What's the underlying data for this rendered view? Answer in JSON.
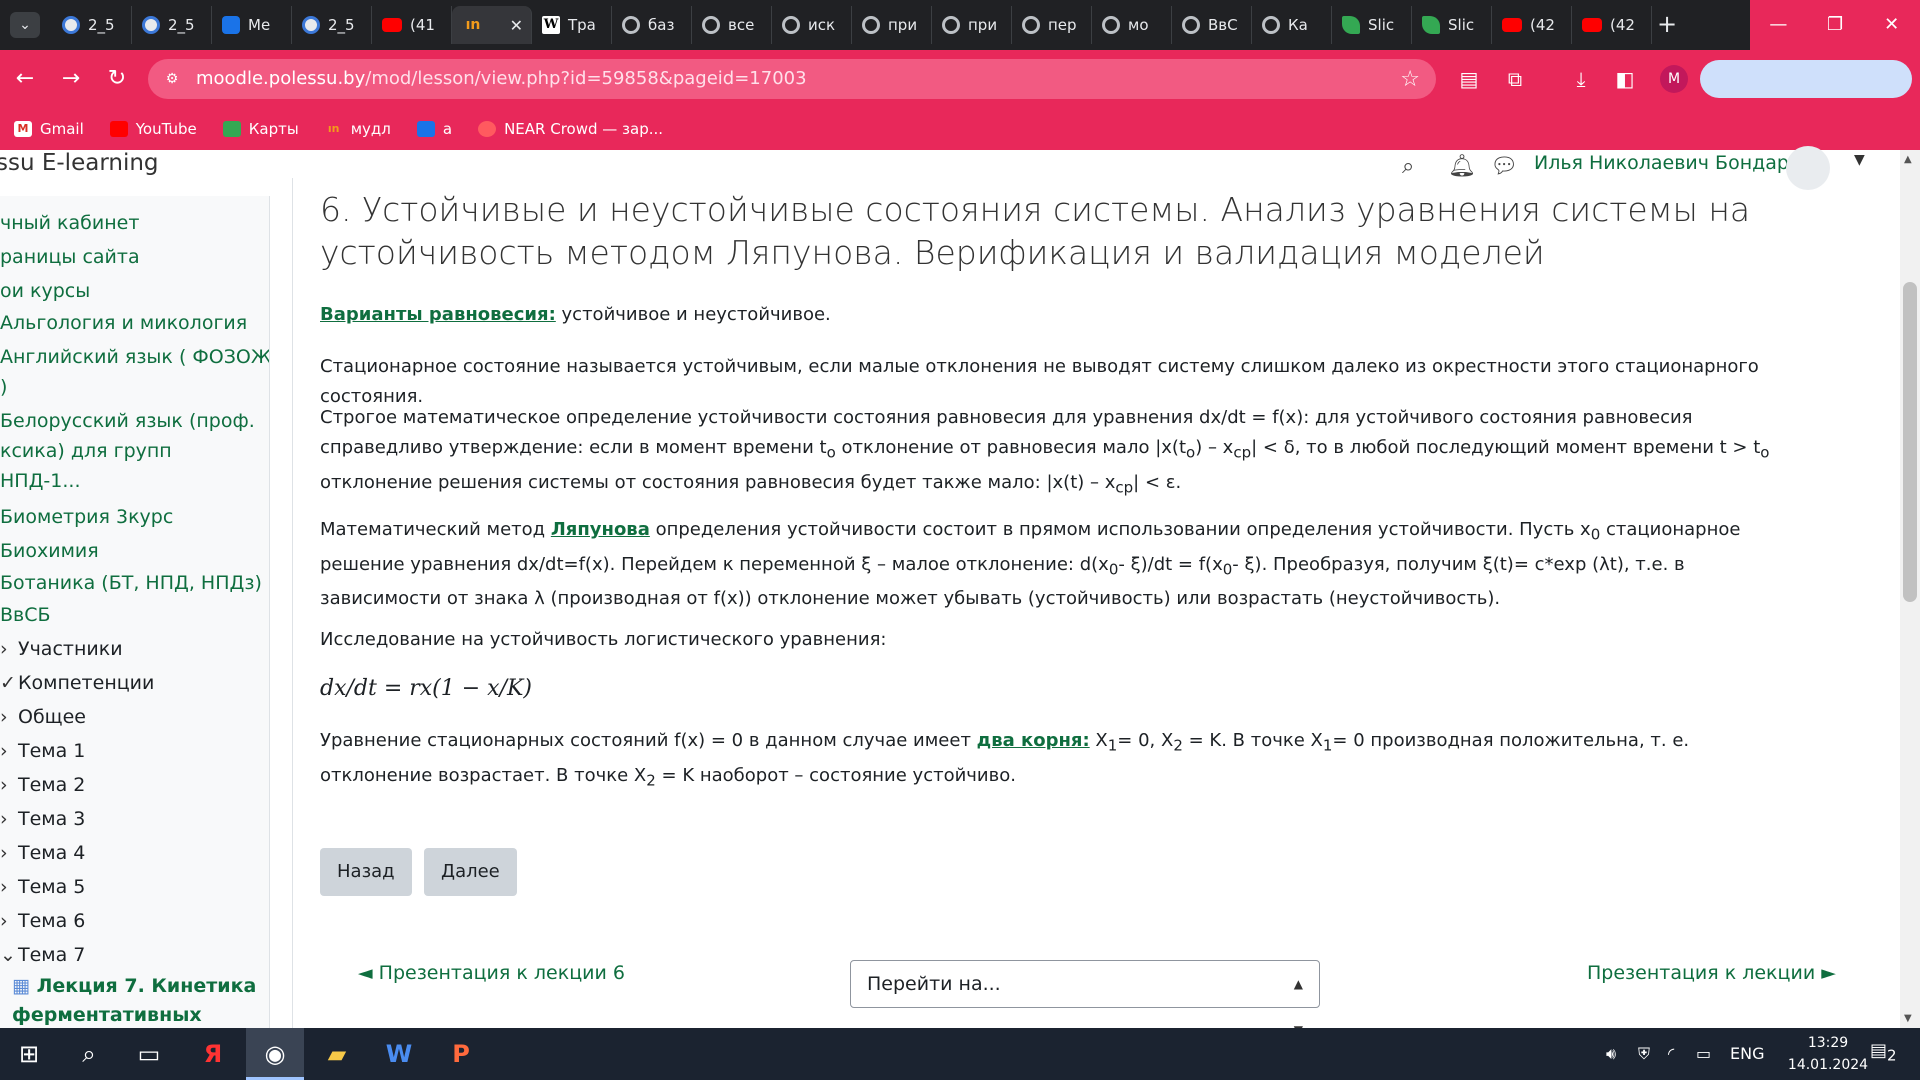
{
  "browser": {
    "tabs": [
      {
        "title": "2_5",
        "icon": "moodle-icon"
      },
      {
        "title": "2_5",
        "icon": "moodle-icon"
      },
      {
        "title": "Ме",
        "icon": "chat-icon"
      },
      {
        "title": "2_5",
        "icon": "moodle-icon"
      },
      {
        "title": "(41",
        "icon": "youtube-icon"
      },
      {
        "title": "",
        "icon": "moodle-orange-icon",
        "active": true
      },
      {
        "title": "Тра",
        "icon": "wikipedia-icon"
      },
      {
        "title": "баз",
        "icon": "ring-icon"
      },
      {
        "title": "все",
        "icon": "ring-icon"
      },
      {
        "title": "иск",
        "icon": "ring-icon"
      },
      {
        "title": "при",
        "icon": "ring-icon"
      },
      {
        "title": "при",
        "icon": "ring-icon"
      },
      {
        "title": "пер",
        "icon": "ring-icon"
      },
      {
        "title": "мо",
        "icon": "ring-icon"
      },
      {
        "title": "ВвС",
        "icon": "ring-icon"
      },
      {
        "title": "Ка",
        "icon": "ring-icon"
      },
      {
        "title": "Slic",
        "icon": "slides-icon"
      },
      {
        "title": "Slic",
        "icon": "slides-icon"
      },
      {
        "title": "(42",
        "icon": "youtube-icon"
      },
      {
        "title": "(42",
        "icon": "youtube-icon"
      }
    ],
    "url_host": "moodle.polessu.by",
    "url_path": "/mod/lesson/view.php?id=59858&pageid=17003",
    "profile_letter": "M",
    "bookmarks": [
      {
        "label": "Gmail",
        "icon": "gmail-icon"
      },
      {
        "label": "YouTube",
        "icon": "youtube-icon"
      },
      {
        "label": "Карты",
        "icon": "maps-icon"
      },
      {
        "label": "мудл",
        "icon": "moodle-orange-icon"
      },
      {
        "label": "а",
        "icon": "chat-icon"
      },
      {
        "label": "NEAR Crowd — зар...",
        "icon": "near-icon"
      }
    ],
    "accent": "#e8285a"
  },
  "header": {
    "brand": "ssu E-learning",
    "user_name": "Илья Николаевич Бондарь"
  },
  "sidebar": {
    "top_links": [
      "чный кабинет",
      "раницы сайта",
      "ои курсы"
    ],
    "courses": [
      "Альгология и микология",
      "Английский язык ( ФОЗОЖ,",
      ")",
      "Белорусский язык (проф.",
      "ксика) для групп",
      "НПД-1...",
      "Биометрия 3курс",
      "Биохимия",
      "Ботаника (БТ, НПД, НПДз)",
      "ВвСБ"
    ],
    "sections": [
      {
        "label": "Участники",
        "chev": "›"
      },
      {
        "label": "Компетенции",
        "chev": "✓"
      },
      {
        "label": "Общее",
        "chev": "›"
      },
      {
        "label": "Тема 1",
        "chev": "›"
      },
      {
        "label": "Тема 2",
        "chev": "›"
      },
      {
        "label": "Тема 3",
        "chev": "›"
      },
      {
        "label": "Тема 4",
        "chev": "›"
      },
      {
        "label": "Тема 5",
        "chev": "›"
      },
      {
        "label": "Тема 6",
        "chev": "›"
      },
      {
        "label": "Тема 7",
        "chev": "⌄"
      }
    ],
    "lesson_label": "Лекция 7. Кинетика ферментативных"
  },
  "content": {
    "title": "6. Устойчивые и неустойчивые состояния системы. Анализ уравнения системы на устойчивость методом Ляпунова. Верификация и валидация моделей",
    "p1_link": "Варианты равновесия:",
    "p1_text": " устойчивое и неустойчивое.",
    "p2": "Стационарное состояние называется устойчивым, если малые отклонения не выводят систему слишком далеко из окрестности этого стационарного состояния.",
    "p3_a": "Строгое математическое определение устойчивости состояния равновесия для уравнения dx/dt = f(x): для устойчивого состояния равновесия справедливо утверждение: если в момент времени t",
    "p3_sub1": "o",
    "p3_b": " отклонение от равновесия мало |x(t",
    "p3_sub2": "o",
    "p3_c": ") – x",
    "p3_sub3": "cp",
    "p3_d": "| < δ, то в любой последующий момент времени t > t",
    "p3_sub4": "o",
    "p3_e": " отклонение решения системы от состояния равновесия будет также мало: |x(t) – x",
    "p3_sub5": "cp",
    "p3_f": "| < ε.",
    "p4_a": "Математический метод ",
    "p4_link": "Ляпунова",
    "p4_b": " определения устойчивости состоит в прямом использовании определения устойчивости. Пусть x",
    "p4_sub1": "0",
    "p4_c": " стационарное решение уравнения dx/dt=f(x). Перейдем к переменной ξ – малое отклонение: d(x",
    "p4_sub2": "0",
    "p4_d": "- ξ)/dt = f(x",
    "p4_sub3": "0",
    "p4_e": "- ξ). Преобразуя, получим ξ(t)= c*exp (λt), т.е. в зависимости от знака λ (производная от f(x)) отклонение может убывать (устойчивость) или возрастать (неустойчивость).",
    "p5": "Исследование на устойчивость логистического уравнения:",
    "formula": "dx/dt = rx(1 − x/K)",
    "p6_a": "Уравнение стационарных состояний f(x) = 0 в данном случае имеет ",
    "p6_link": "два корня:",
    "p6_b": " X",
    "p6_sub1": "1",
    "p6_c": "= 0, X",
    "p6_sub2": "2",
    "p6_d": " = K. В точке X",
    "p6_sub3": "1",
    "p6_e": "= 0 производная положительна, т. е. отклонение возрастает. В точке X",
    "p6_sub4": "2",
    "p6_f": " = K наоборот – состояние устойчиво.",
    "btn_back": "Назад",
    "btn_next": "Далее",
    "prev_link": "◄ Презентация к лекции 6",
    "jump_placeholder": "Перейти на...",
    "next_link": "Презентация к лекции ►"
  },
  "taskbar": {
    "lang": "ENG",
    "time": "13:29",
    "date": "14.01.2024",
    "notif_count": "2"
  }
}
